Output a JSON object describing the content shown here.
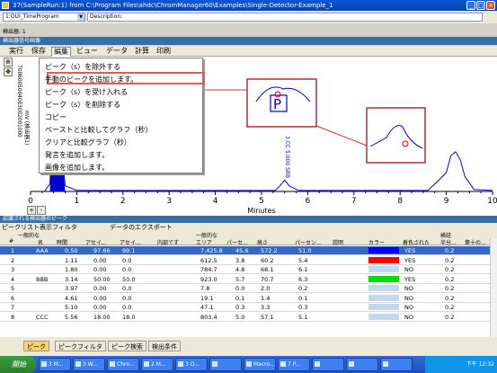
{
  "window": {
    "title": "37(SampleRun:1) from C:\\Program Files\\ahdc\\ChromManager60\\Examples\\Single-Detector-Example_1"
  },
  "toolbar": {
    "method_value": "1:OUI_TimeProgram",
    "desc_value": "Description:"
  },
  "detector_label": "検出器: 1",
  "panel": {
    "title": "検出器信号画像"
  },
  "menus": [
    "実行",
    "保存",
    "編集",
    "ビュー",
    "データ",
    "計算",
    "印刷"
  ],
  "context_menu": {
    "items": [
      "ピーク（s）を除外する",
      "手動のピークを追加します。",
      "ピーク（s）を受け入れる",
      "ピーク（s）を削除する",
      "コピー",
      "ペーストと比較してグラフ（秒）",
      "クリアと比較グラフ（秒）",
      "発言を追加します。",
      "画像を追加します。"
    ]
  },
  "chart_data": {
    "type": "line",
    "x_ticks": [
      "0",
      "1",
      "2",
      "3",
      "4",
      "5",
      "6",
      "7",
      "8",
      "9",
      "10"
    ],
    "xlabel": "Minutes",
    "ylabel": "mV (検出器1)",
    "y_ticks": [
      "700",
      "600",
      "500",
      "400",
      "300",
      "200",
      "100",
      "0"
    ],
    "xlim": [
      0,
      10
    ],
    "ylim": [
      0,
      700
    ],
    "peak_label": "3.CC 5.000 SBB",
    "series": [
      {
        "x": [
          0.3,
          0.42,
          0.5,
          0.55,
          0.6,
          0.75,
          1,
          1.5,
          2,
          3,
          4,
          5,
          5.3,
          5.4,
          5.5,
          5.6,
          5.8,
          6,
          7,
          8.6,
          8.8,
          9.0,
          9.1,
          9.2,
          9.3,
          9.4,
          9.6,
          10
        ],
        "y": [
          0,
          40,
          500,
          700,
          420,
          30,
          5,
          5,
          5,
          5,
          5,
          5,
          5,
          30,
          60,
          30,
          5,
          5,
          5,
          5,
          50,
          100,
          190,
          210,
          170,
          80,
          10,
          5
        ]
      }
    ]
  },
  "zoom": {
    "in": "+",
    "out": "-"
  },
  "peaks_panel": {
    "title": "認識される検出器のピーク",
    "filter_label": "ピークリスト表示フィルタ",
    "export_label": "データのエクスポート"
  },
  "table": {
    "groups": [
      "一般的な",
      "一般的な",
      "検証"
    ],
    "headers": [
      "#",
      "名",
      "時間",
      "アセイ...",
      "アセイ...",
      "内部です",
      "エリア",
      "パーセ...",
      "高さ",
      "パーセン...",
      "説明",
      "カラー",
      "着色された",
      "半分...",
      "第十の..."
    ],
    "rows": [
      {
        "n": "1",
        "name": "AAA",
        "time": "0.50",
        "a1": "97.66",
        "a2": "99.1",
        "area": "7,425.8",
        "pct": "45.6",
        "height": "572.2",
        "hpct": "51.0",
        "color": "#0000ff",
        "colored": "YES",
        "half": "0.2"
      },
      {
        "n": "2",
        "name": "",
        "time": "1.11",
        "a1": "0.00",
        "a2": "0.0",
        "area": "612.5",
        "pct": "3.8",
        "height": "60.2",
        "hpct": "5.4",
        "color": "#ff0000",
        "colored": "YES",
        "half": "0.2"
      },
      {
        "n": "3",
        "name": "",
        "time": "1.80",
        "a1": "0.00",
        "a2": "0.0",
        "area": "784.7",
        "pct": "4.8",
        "height": "68.1",
        "hpct": "6.1",
        "color": "#c0d8f0",
        "colored": "NO",
        "half": "0.2"
      },
      {
        "n": "4",
        "name": "BBB",
        "time": "3.14",
        "a1": "50.00",
        "a2": "50.0",
        "area": "923.0",
        "pct": "5.7",
        "height": "70.7",
        "hpct": "6.3",
        "color": "#00e000",
        "colored": "YES",
        "half": "0.2"
      },
      {
        "n": "5",
        "name": "",
        "time": "3.97",
        "a1": "0.00",
        "a2": "0.0",
        "area": "7.8",
        "pct": "0.0",
        "height": "2.0",
        "hpct": "0.2",
        "color": "#c0d8f0",
        "colored": "NO",
        "half": "0.2"
      },
      {
        "n": "6",
        "name": "",
        "time": "4.61",
        "a1": "0.00",
        "a2": "0.0",
        "area": "19.1",
        "pct": "0.1",
        "height": "1.4",
        "hpct": "0.1",
        "color": "#c0d8f0",
        "colored": "NO",
        "half": "0.2"
      },
      {
        "n": "7",
        "name": "",
        "time": "5.10",
        "a1": "0.00",
        "a2": "0.0",
        "area": "47.1",
        "pct": "0.3",
        "height": "3.3",
        "hpct": "0.3",
        "color": "#c0d8f0",
        "colored": "NO",
        "half": "0.2"
      },
      {
        "n": "8",
        "name": "CCC",
        "time": "5.56",
        "a1": "18.00",
        "a2": "18.0",
        "area": "803.4",
        "pct": "5.0",
        "height": "57.1",
        "hpct": "5.1",
        "color": "#c0d8f0",
        "colored": "NO",
        "half": "0.2"
      }
    ]
  },
  "bottom_tabs": [
    "ピーク",
    "ピークフィルタ",
    "ピーク検索",
    "検出条件"
  ],
  "taskbar": {
    "start": "開始",
    "items": [
      "3 M...",
      "3 W...",
      "Chro...",
      "2 M...",
      "3 O...",
      "",
      "Macro...",
      "7 P...",
      "",
      "",
      ""
    ],
    "clock": "下午 12:32"
  }
}
